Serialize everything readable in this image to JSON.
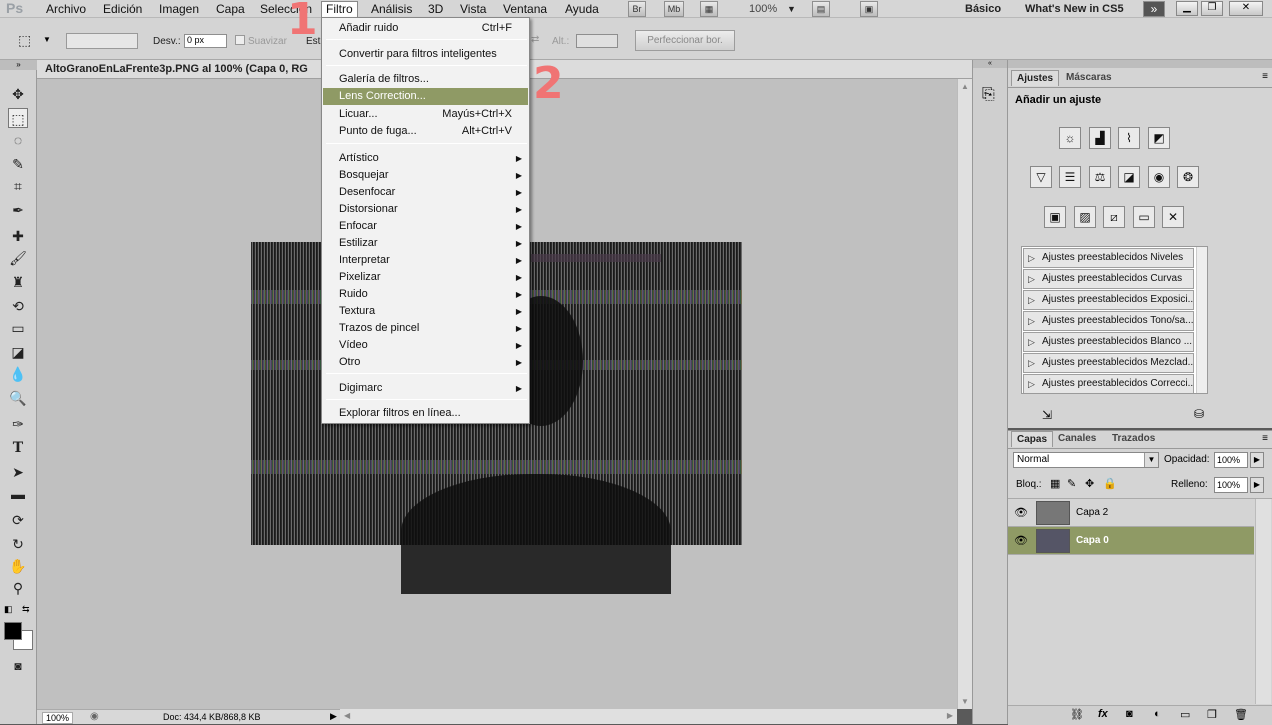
{
  "menubar": {
    "logo": "Ps",
    "items": [
      "Archivo",
      "Edición",
      "Imagen",
      "Capa",
      "Selección",
      "Filtro",
      "Análisis",
      "3D",
      "Vista",
      "Ventana",
      "Ayuda"
    ],
    "mini_br": "Br",
    "mini_mb": "Mb",
    "zoom": "100%",
    "workspace": "Básico",
    "whats_new": "What's New in CS5"
  },
  "options": {
    "desvan_label": "Desv.:",
    "desvan_value": "0 px",
    "suavizar": "Suavizar",
    "estilo_short": "Esti",
    "alt_label": "Alt.:",
    "perfeccionar": "Perfeccionar bor."
  },
  "document": {
    "title": "AltoGranoEnLaFrente3p.PNG al 100% (Capa 0, RG",
    "zoom": "100%",
    "doc_info": "Doc: 434,4 KB/868,8 KB"
  },
  "filter_menu": {
    "items": [
      {
        "label": "Añadir ruido",
        "shortcut": "Ctrl+F"
      },
      {
        "label": "Convertir para filtros inteligentes"
      },
      {
        "label": "Galería de filtros..."
      },
      {
        "label": "Lens Correction..."
      },
      {
        "label": "Licuar...",
        "shortcut": "Mayús+Ctrl+X"
      },
      {
        "label": "Punto de fuga...",
        "shortcut": "Alt+Ctrl+V"
      },
      {
        "label": "Artístico"
      },
      {
        "label": "Bosquejar"
      },
      {
        "label": "Desenfocar"
      },
      {
        "label": "Distorsionar"
      },
      {
        "label": "Enfocar"
      },
      {
        "label": "Estilizar"
      },
      {
        "label": "Interpretar"
      },
      {
        "label": "Pixelizar"
      },
      {
        "label": "Ruido"
      },
      {
        "label": "Textura"
      },
      {
        "label": "Trazos de pincel"
      },
      {
        "label": "Vídeo"
      },
      {
        "label": "Otro"
      },
      {
        "label": "Digimarc"
      },
      {
        "label": "Explorar filtros en línea..."
      }
    ]
  },
  "annotations": {
    "one": "1",
    "two": "2"
  },
  "adjustments": {
    "tab_ajustes": "Ajustes",
    "tab_mascaras": "Máscaras",
    "heading": "Añadir un ajuste",
    "presets": [
      "Ajustes preestablecidos Niveles",
      "Ajustes preestablecidos Curvas",
      "Ajustes preestablecidos Exposici...",
      "Ajustes preestablecidos Tono/sa...",
      "Ajustes preestablecidos Blanco ...",
      "Ajustes preestablecidos Mezclad...",
      "Ajustes preestablecidos Correcci..."
    ]
  },
  "layers": {
    "tab_capas": "Capas",
    "tab_canales": "Canales",
    "tab_trazados": "Trazados",
    "blend_mode": "Normal",
    "opacity_label": "Opacidad:",
    "opacity_value": "100%",
    "lock_label": "Bloq.:",
    "fill_label": "Relleno:",
    "fill_value": "100%",
    "rows": [
      {
        "name": "Capa 2"
      },
      {
        "name": "Capa 0"
      }
    ]
  },
  "colors": {
    "highlight": "#8f9a65",
    "annotation": "#f07474"
  }
}
